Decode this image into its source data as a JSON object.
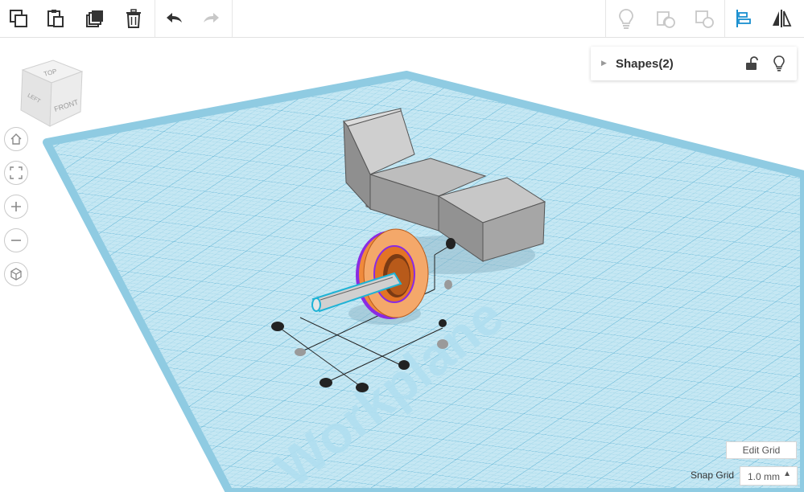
{
  "toolbar": {
    "left_tools": [
      {
        "icon": "copy-icon"
      },
      {
        "icon": "paste-icon"
      },
      {
        "icon": "duplicate-icon"
      },
      {
        "icon": "delete-icon"
      },
      {
        "icon": "undo-icon"
      },
      {
        "icon": "redo-icon"
      }
    ],
    "right_tools": [
      {
        "icon": "lightbulb-icon"
      },
      {
        "icon": "group-icon"
      },
      {
        "icon": "ungroup-icon"
      },
      {
        "icon": "align-icon"
      },
      {
        "icon": "mirror-icon"
      }
    ]
  },
  "view_cube": {
    "top": "TOP",
    "left": "LEFT",
    "front": "FRONT"
  },
  "nav_controls": [
    {
      "icon": "home-view-icon"
    },
    {
      "icon": "fit-view-icon"
    },
    {
      "icon": "zoom-in-icon"
    },
    {
      "icon": "zoom-out-icon"
    },
    {
      "icon": "perspective-icon"
    }
  ],
  "shapes_panel": {
    "title": "Shapes(2)",
    "icons": [
      "lock-open-icon",
      "lightbulb-icon"
    ]
  },
  "workplane": {
    "label": "Workplane",
    "color": "#9fd6ea"
  },
  "colors": {
    "accent": "#1a8fcf",
    "ring": "#f08a3c",
    "selection": "#8a2be2",
    "shape_gray": "#a9a9a9"
  },
  "grid": {
    "edit_label": "Edit Grid",
    "snap_label": "Snap Grid",
    "snap_value": "1.0 mm"
  }
}
